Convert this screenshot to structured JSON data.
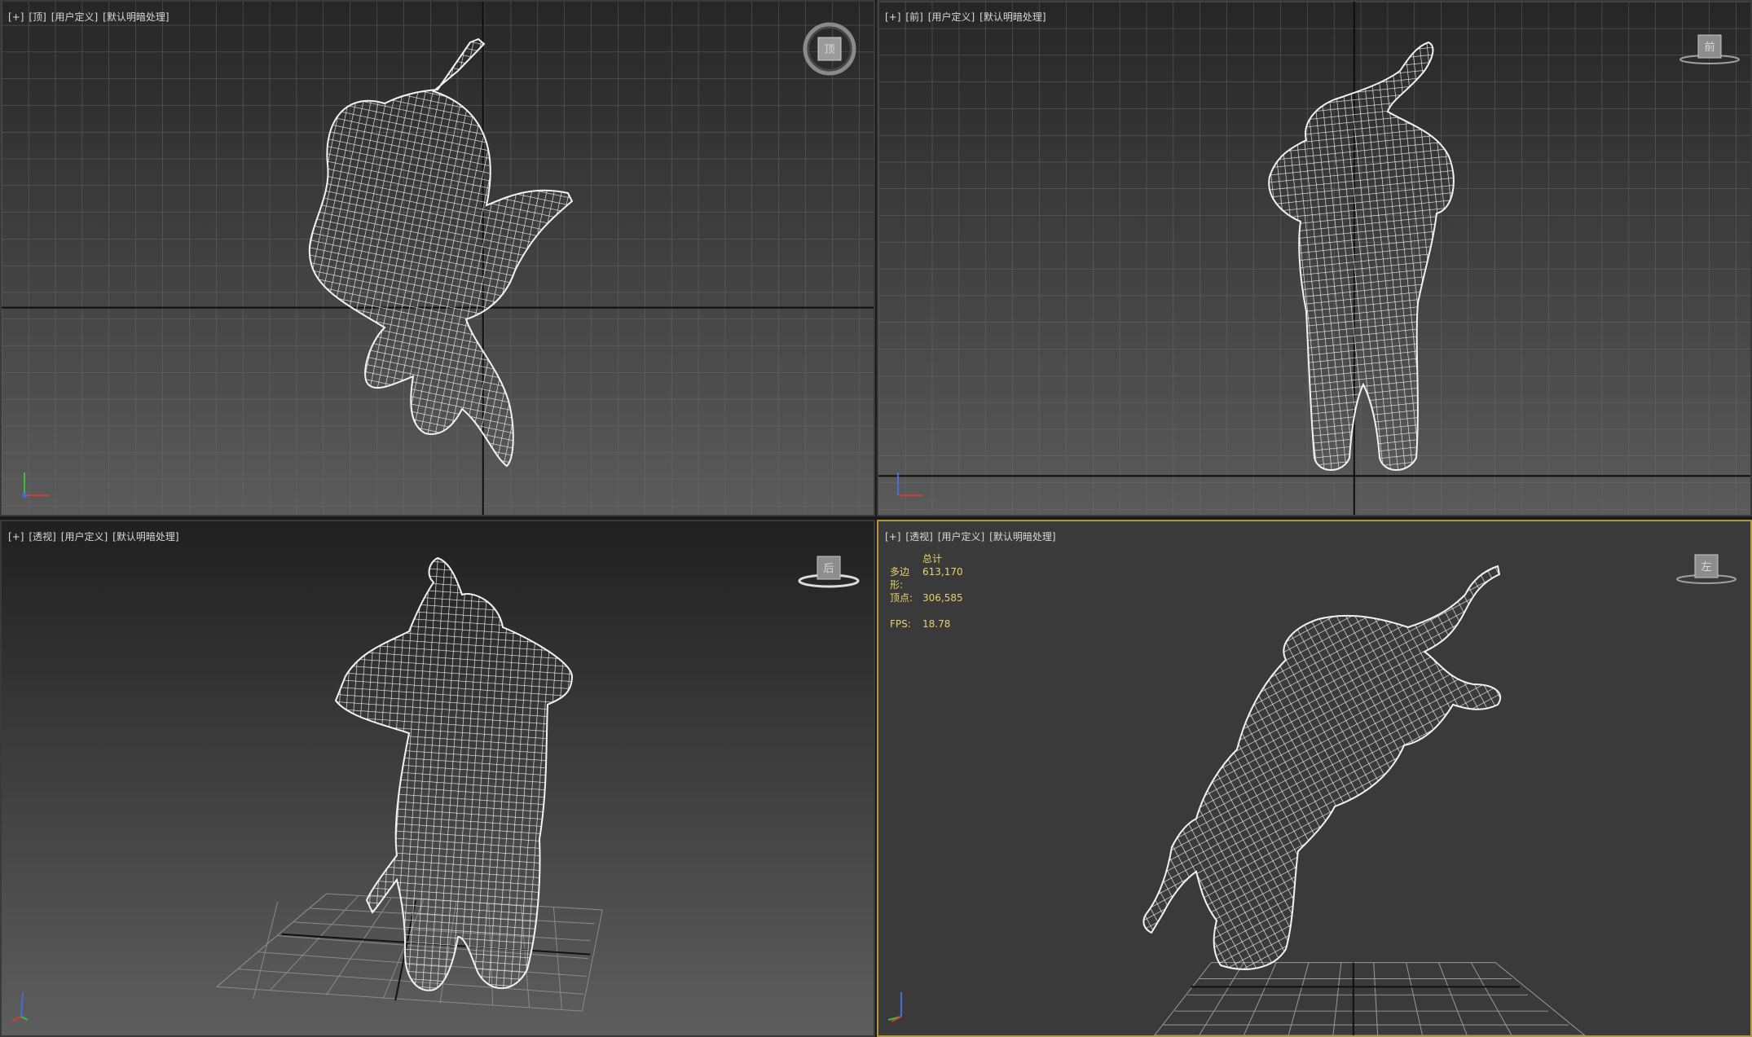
{
  "viewports": [
    {
      "name": "top",
      "labels": [
        "[+]",
        "[顶]",
        "[用户定义]",
        "[默认明暗处理]"
      ],
      "cube_face": "顶"
    },
    {
      "name": "front",
      "labels": [
        "[+]",
        "[前]",
        "[用户定义]",
        "[默认明暗处理]"
      ],
      "cube_face": "前"
    },
    {
      "name": "perspective",
      "labels": [
        "[+]",
        "[透视]",
        "[用户定义]",
        "[默认明暗处理]"
      ],
      "cube_face": "后"
    },
    {
      "name": "orthographic",
      "labels": [
        "[+]",
        "[透视]",
        "[用户定义]",
        "[默认明暗处理]"
      ],
      "cube_face": "左"
    }
  ],
  "stats": {
    "header": "总计",
    "polygons_label": "多边形:",
    "polygons_value": "613,170",
    "vertices_label": "顶点:",
    "vertices_value": "306,585",
    "fps_label": "FPS:",
    "fps_value": "18.78"
  },
  "colors": {
    "accent": "#b8973a",
    "stats": "#e6d36a",
    "wire": "#f2f2f2"
  }
}
